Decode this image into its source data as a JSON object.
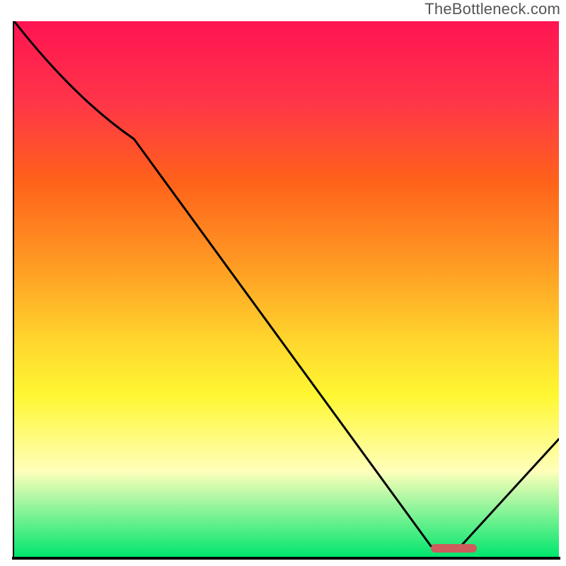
{
  "header": {
    "watermark": "TheBottleneck.com"
  },
  "chart_data": {
    "type": "line",
    "title": "",
    "xlabel": "",
    "ylabel": "",
    "xlim": [
      0,
      100
    ],
    "ylim": [
      0,
      100
    ],
    "series": [
      {
        "name": "curve",
        "x": [
          0,
          22,
          76.5,
          82,
          100
        ],
        "y": [
          100,
          78,
          2,
          2,
          22
        ]
      }
    ],
    "annotations": [
      {
        "name": "bottleneck-marker",
        "x_start": 76.5,
        "x_end": 85,
        "y": 1.6,
        "color": "#cd5c5c"
      }
    ],
    "gradient_stops": [
      {
        "offset": 0,
        "color": "#ff1452"
      },
      {
        "offset": 15,
        "color": "#ff3549"
      },
      {
        "offset": 30,
        "color": "#ff621a"
      },
      {
        "offset": 45,
        "color": "#ff9923"
      },
      {
        "offset": 60,
        "color": "#ffd72d"
      },
      {
        "offset": 70,
        "color": "#fff733"
      },
      {
        "offset": 84,
        "color": "#ffffbb"
      },
      {
        "offset": 100,
        "color": "#00e66e"
      }
    ]
  }
}
